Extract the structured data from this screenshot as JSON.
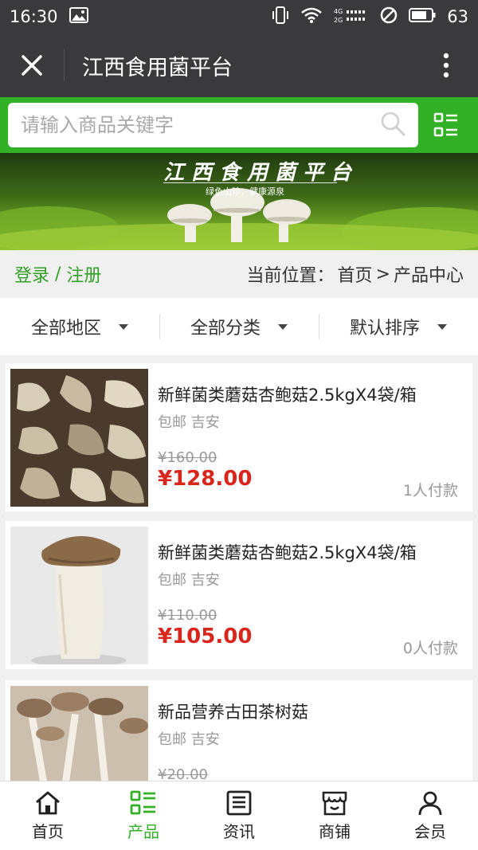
{
  "status_bar": {
    "time": "16:30",
    "battery": "63"
  },
  "title_bar": {
    "title": "江西食用菌平台"
  },
  "search": {
    "placeholder": "请输入商品关键字"
  },
  "banner": {
    "title": "江西食用菌平台",
    "slogan": "绿色山珍，健康源泉"
  },
  "location_bar": {
    "login": "登录",
    "slash": " / ",
    "register": "注册",
    "label": "当前位置：",
    "home": "首页",
    "sep": ">",
    "current": "产品中心"
  },
  "filters": [
    {
      "label": "全部地区"
    },
    {
      "label": "全部分类"
    },
    {
      "label": "默认排序"
    }
  ],
  "products": [
    {
      "name": "新鲜菌类蘑菇杏鲍菇2.5kgX4袋/箱",
      "shipping": "包邮",
      "location": "吉安",
      "original_price": "¥160.00",
      "price": "¥128.00",
      "paid": "1人付款"
    },
    {
      "name": "新鲜菌类蘑菇杏鲍菇2.5kgX4袋/箱",
      "shipping": "包邮",
      "location": "吉安",
      "original_price": "¥110.00",
      "price": "¥105.00",
      "paid": "0人付款"
    },
    {
      "name": "新品营养古田茶树菇",
      "shipping": "包邮",
      "location": "吉安",
      "original_price": "¥20.00",
      "price": "",
      "paid": ""
    }
  ],
  "tabs": [
    {
      "label": "首页",
      "icon": "home-icon"
    },
    {
      "label": "产品",
      "icon": "grid-list-icon"
    },
    {
      "label": "资讯",
      "icon": "news-icon"
    },
    {
      "label": "商铺",
      "icon": "shop-icon"
    },
    {
      "label": "会员",
      "icon": "user-icon"
    }
  ],
  "colors": {
    "brand_green": "#32b026",
    "dark_bar": "#3a3a3d",
    "price_red": "#d9261c"
  }
}
